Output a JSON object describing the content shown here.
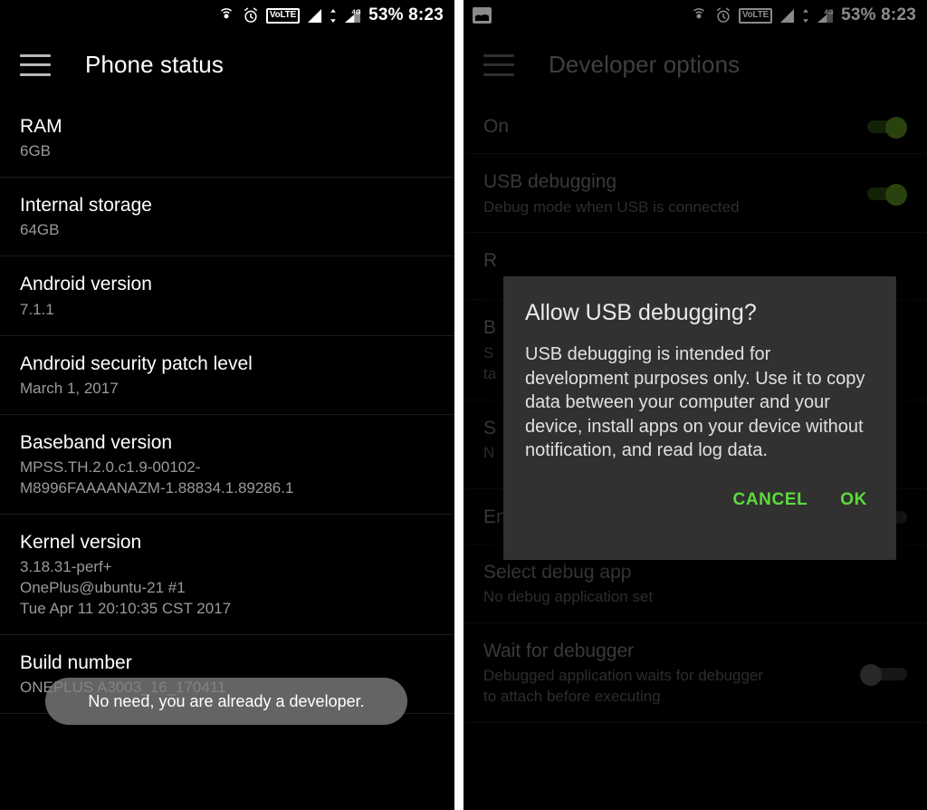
{
  "status_bar": {
    "icons_left": [
      "photo-notification-icon"
    ],
    "icons_right": [
      "hotspot-icon",
      "alarm-icon",
      "volte-icon",
      "signal-icon",
      "data-arrows-icon",
      "signal-2-icon"
    ],
    "volte_label": "VoLTE",
    "network_label": "4G",
    "battery": "53%",
    "time": "8:23",
    "battery_time": "53% 8:23"
  },
  "left_panel": {
    "title": "Phone status",
    "menu_icon": "hamburger-menu-icon",
    "items": [
      {
        "title": "RAM",
        "sub": "6GB"
      },
      {
        "title": "Internal storage",
        "sub": "64GB"
      },
      {
        "title": "Android version",
        "sub": "7.1.1"
      },
      {
        "title": "Android security patch level",
        "sub": "March 1, 2017"
      },
      {
        "title": "Baseband version",
        "sub": "MPSS.TH.2.0.c1.9-00102-\nM8996FAAAANAZM-1.88834.1.89286.1"
      },
      {
        "title": "Kernel version",
        "sub": "3.18.31-perf+\nOnePlus@ubuntu-21 #1\nTue Apr 11 20:10:35 CST 2017"
      },
      {
        "title": "Build number",
        "sub": "ONEPLUS A3003_16_170411"
      }
    ],
    "toast": "No need, you are already a developer."
  },
  "right_panel": {
    "title": "Developer options",
    "menu_icon": "hamburger-menu-icon",
    "items": [
      {
        "title": "On",
        "sub": "",
        "toggle": "on"
      },
      {
        "title": "USB debugging",
        "sub": "Debug mode when USB is connected",
        "toggle": "on"
      },
      {
        "title": "R",
        "sub": "",
        "toggle": ""
      },
      {
        "title": "B",
        "sub": "S\nta",
        "toggle": ""
      },
      {
        "title": "S",
        "sub": "N",
        "toggle": ""
      },
      {
        "title": "Enable view attribute inspection",
        "sub": "",
        "toggle": "off"
      },
      {
        "title": "Select debug app",
        "sub": "No debug application set",
        "toggle": ""
      },
      {
        "title": "Wait for debugger",
        "sub": "Debugged application waits for debugger\nto attach before executing",
        "toggle": "off"
      }
    ],
    "dialog": {
      "title": "Allow USB debugging?",
      "body": "USB debugging is intended for development purposes only. Use it to copy data between your computer and your device, install apps on your device without notification, and read log data.",
      "cancel_label": "CANCEL",
      "ok_label": "OK"
    }
  },
  "colors": {
    "accent_green": "#5cdb3c",
    "toggle_on": "#4e7d1b",
    "dialog_bg": "#313131",
    "background": "#000000"
  }
}
